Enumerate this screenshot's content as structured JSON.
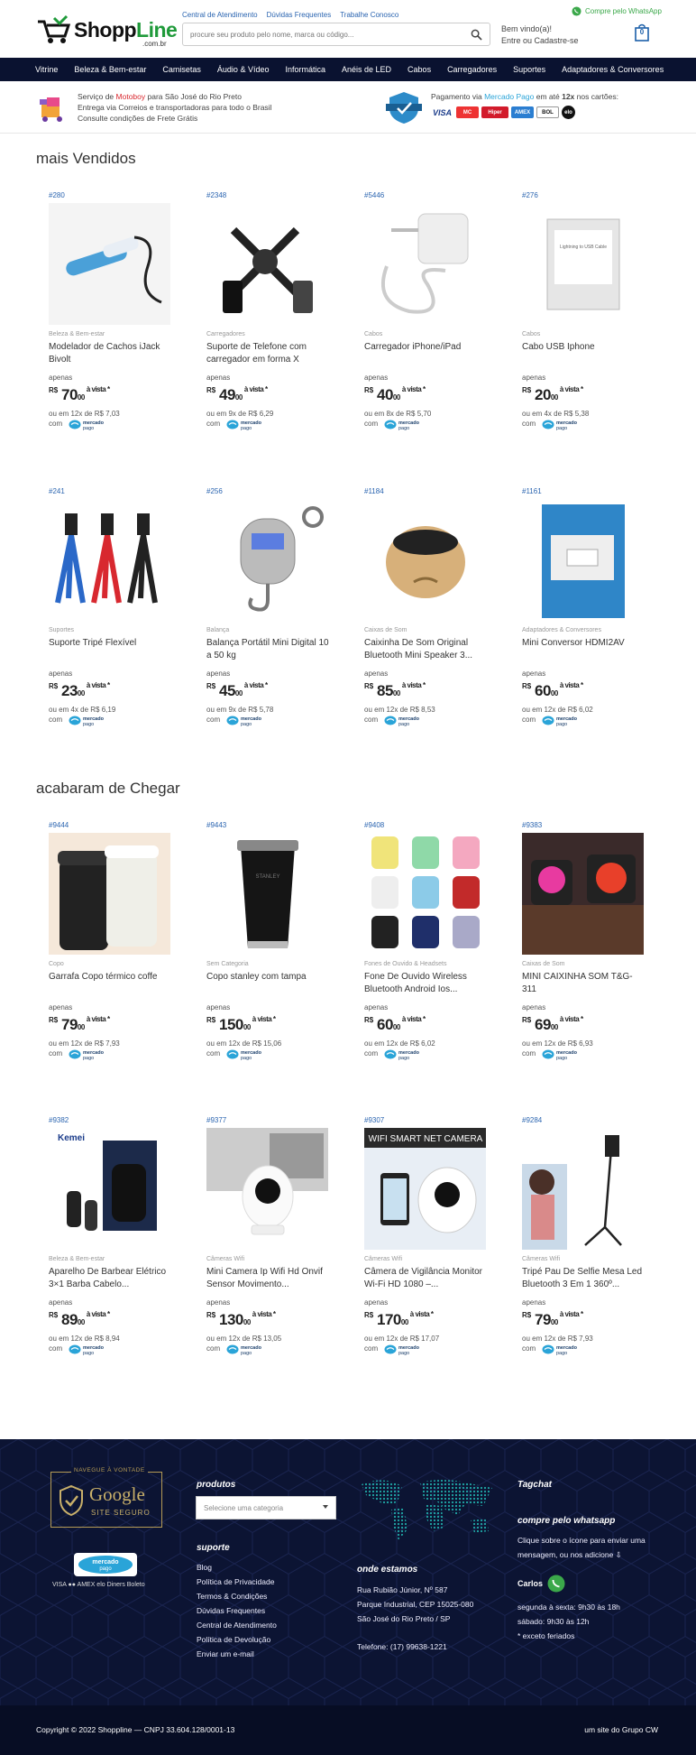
{
  "header": {
    "brand_a": "Shopp",
    "brand_b": "Line",
    "brand_domain": ".com.br",
    "top_links": [
      "Central de Atendimento",
      "Dúvidas Frequentes",
      "Trabalhe Conosco"
    ],
    "search_placeholder": "procure seu produto pelo nome, marca ou código...",
    "welcome": "Bem vindo(a)!",
    "login": "Entre ou Cadastre-se",
    "whatsapp": "Compre pelo WhatsApp",
    "cart_count": "0"
  },
  "nav": [
    "Vitrine",
    "Beleza & Bem-estar",
    "Camisetas",
    "Áudio & Vídeo",
    "Informática",
    "Anéis de LED",
    "Cabos",
    "Carregadores",
    "Suportes",
    "Adaptadores & Conversores"
  ],
  "info": {
    "line1_a": "Serviço de ",
    "line1_b": "Motoboy",
    "line1_c": " para São José do Rio Preto",
    "line2": "Entrega via Correios e transportadoras para todo o Brasil",
    "line3": "Consulte condições de Frete Grátis",
    "pay_a": "Pagamento via ",
    "pay_b": "Mercado Pago",
    "pay_c": " em até ",
    "pay_d": "12x",
    "pay_e": " nos cartões:",
    "cards": [
      "VISA",
      "MC",
      "Hiper",
      "AMEX",
      "BOL",
      "elo"
    ]
  },
  "sections": [
    {
      "title": "mais Vendidos",
      "products": [
        {
          "sku": "#280",
          "category": "Beleza & Bem-estar",
          "name": "Modelador de Cachos iJack Bivolt",
          "int": "70",
          "cents": "00",
          "installments": "ou em 12x de R$ 7,03"
        },
        {
          "sku": "#2348",
          "category": "Carregadores",
          "name": "Suporte de Telefone com carregador em forma X",
          "int": "49",
          "cents": "00",
          "installments": "ou em 9x de R$ 6,29"
        },
        {
          "sku": "#5446",
          "category": "Cabos",
          "name": "Carregador iPhone/iPad",
          "int": "40",
          "cents": "00",
          "installments": "ou em 8x de R$ 5,70"
        },
        {
          "sku": "#276",
          "category": "Cabos",
          "name": "Cabo USB Iphone",
          "int": "20",
          "cents": "00",
          "installments": "ou em 4x de R$ 5,38"
        },
        {
          "sku": "#241",
          "category": "Suportes",
          "name": "Suporte Tripé Flexível",
          "int": "23",
          "cents": "00",
          "installments": "ou em 4x de R$ 6,19"
        },
        {
          "sku": "#256",
          "category": "Balança",
          "name": "Balança Portátil Mini Digital 10 a 50 kg",
          "int": "45",
          "cents": "00",
          "installments": "ou em 9x de R$ 5,78"
        },
        {
          "sku": "#1184",
          "category": "Caixas de Som",
          "name": "Caixinha De Som Original Bluetooth Mini Speaker 3...",
          "int": "85",
          "cents": "00",
          "installments": "ou em 12x de R$ 8,53"
        },
        {
          "sku": "#1161",
          "category": "Adaptadores & Conversores",
          "name": "Mini Conversor HDMI2AV",
          "int": "60",
          "cents": "00",
          "installments": "ou em 12x de R$ 6,02"
        }
      ]
    },
    {
      "title": "acabaram de Chegar",
      "products": [
        {
          "sku": "#9444",
          "category": "Copo",
          "name": "Garrafa Copo térmico coffe",
          "int": "79",
          "cents": "00",
          "installments": "ou em 12x de R$ 7,93"
        },
        {
          "sku": "#9443",
          "category": "Sem Categoria",
          "name": "Copo stanley com tampa",
          "int": "150",
          "cents": "00",
          "installments": "ou em 12x de R$ 15,06"
        },
        {
          "sku": "#9408",
          "category": "Fones de Ouvido & Headsets",
          "name": "Fone De Ouvido Wireless Bluetooth Android Ios...",
          "int": "60",
          "cents": "00",
          "installments": "ou em 12x de R$ 6,02"
        },
        {
          "sku": "#9383",
          "category": "Caixas de Som",
          "name": "MINI CAIXINHA SOM T&G-311",
          "int": "69",
          "cents": "00",
          "installments": "ou em 12x de R$ 6,93"
        },
        {
          "sku": "#9382",
          "category": "Beleza & Bem-estar",
          "name": "Aparelho De Barbear Elétrico 3×1 Barba Cabelo...",
          "int": "89",
          "cents": "00",
          "installments": "ou em 12x de R$ 8,94"
        },
        {
          "sku": "#9377",
          "category": "Câmeras Wifi",
          "name": "Mini Camera Ip Wifi Hd Onvif Sensor Movimento...",
          "int": "130",
          "cents": "00",
          "installments": "ou em 12x de R$ 13,05"
        },
        {
          "sku": "#9307",
          "category": "Câmeras Wifi",
          "name": "Câmera de Vigilância Monitor Wi-Fi HD 1080 –...",
          "int": "170",
          "cents": "00",
          "installments": "ou em 12x de R$ 17,07"
        },
        {
          "sku": "#9284",
          "category": "Câmeras Wifi",
          "name": "Tripé Pau De Selfie Mesa Led Bluetooth 3 Em 1 360º...",
          "int": "79",
          "cents": "00",
          "installments": "ou em 12x de R$ 7,93"
        }
      ]
    }
  ],
  "labels": {
    "apenas": "apenas",
    "currency": "R$",
    "a_vista": "à vista *",
    "com": "com",
    "mp_a": "mercado",
    "mp_b": "pago"
  },
  "footer": {
    "badge_top": "NAVEGUE À VONTADE",
    "badge_google": "Google",
    "badge_site": "SITE SEGURO",
    "footer_cards": "VISA  ●●  AMEX  elo  Diners  Boleto",
    "produtos_h": "produtos",
    "select_placeholder": "Selecione uma categoria",
    "suporte_h": "suporte",
    "suporte_links": [
      "Blog",
      "Política de Privacidade",
      "Termos & Condições",
      "Dúvidas Frequentes",
      "Central de Atendimento",
      "Política de Devolução",
      "Enviar um e-mail"
    ],
    "onde_h": "onde estamos",
    "address": [
      "Rua Rubião Júnior, Nº 587",
      "Parque Industrial, CEP 15025-080",
      "São José do Rio Preto / SP"
    ],
    "phone": "Telefone: (17) 99638-1221",
    "tagchat": "Tagchat",
    "compre_h": "compre pelo whatsapp",
    "compre_txt1": "Clique sobre o ícone para enviar uma",
    "compre_txt2": "mensagem, ou nos adicione ⇩",
    "carlos": "Carlos",
    "hours": [
      "segunda à sexta: 9h30 às 18h",
      "sábado: 9h30 às 12h",
      "* exceto feriados"
    ],
    "copyright": "Copyright © 2022 Shoppline  —  CNPJ  33.604.128/0001-13",
    "group": "um site do Grupo CW"
  },
  "colors": {
    "nav_bg": "#0a1230",
    "footer_bg": "#0c1433",
    "link": "#2a64b0",
    "brand_green": "#1f9a3a",
    "motoboy_red": "#d9282f",
    "mp_blue": "#2aa4d8"
  }
}
